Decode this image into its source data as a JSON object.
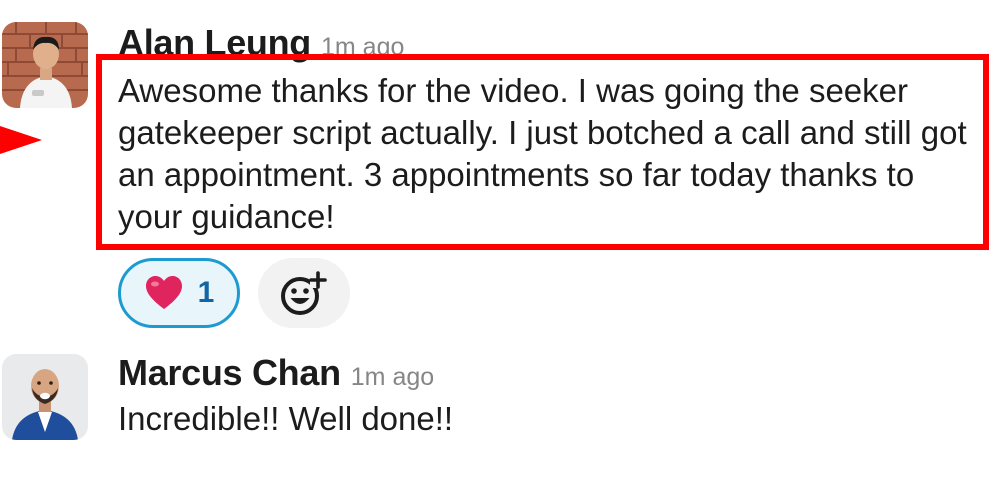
{
  "messages": [
    {
      "author": "Alan Leung",
      "timestamp": "1m ago",
      "text": "Awesome thanks for the video. I was going the seeker gatekeeper script actually. I just botched a call and still got an appointment. 3 appointments so far today thanks to your guidance!",
      "highlight_color": "#ff0000",
      "reactions": [
        {
          "emoji": "heart-icon",
          "count": "1"
        }
      ],
      "add_reaction_icon": "add-reaction-icon"
    },
    {
      "author": "Marcus Chan",
      "timestamp": "1m ago",
      "text": "Incredible!! Well done!!"
    }
  ],
  "colors": {
    "highlight": "#ff0000",
    "reaction_border": "#1d9bd1",
    "reaction_bg": "#e8f5fa",
    "reaction_count": "#1264a3",
    "timestamp": "#868686"
  }
}
